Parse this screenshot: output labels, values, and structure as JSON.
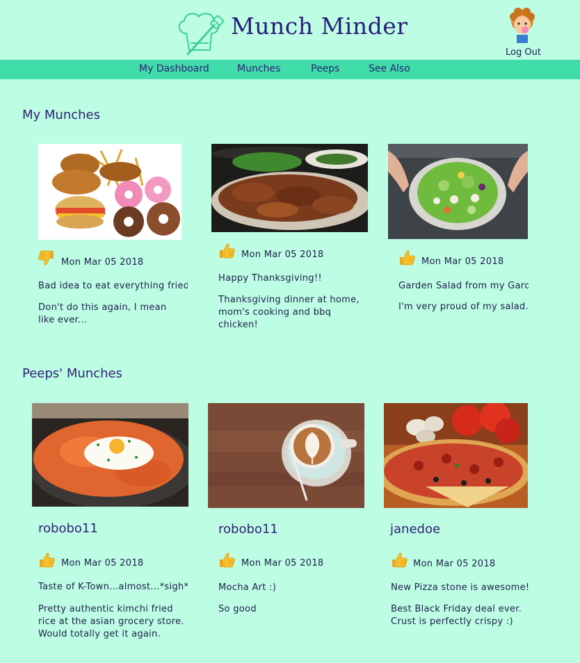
{
  "app": {
    "title": "Munch Minder",
    "logout_label": "Log Out"
  },
  "nav": {
    "items": [
      {
        "label": "My Dashboard"
      },
      {
        "label": "Munches"
      },
      {
        "label": "Peeps"
      },
      {
        "label": "See Also"
      }
    ]
  },
  "my_munches": {
    "title": "My Munches",
    "cards": [
      {
        "photo": "fried-food-photo",
        "rating": "thumbs-down",
        "date": "Mon Mar 05 2018",
        "title": "Bad idea to eat everything fried...",
        "body": "Don't do this again, I mean like ever..."
      },
      {
        "photo": "bbq-chicken-photo",
        "rating": "thumbs-up",
        "date": "Mon Mar 05 2018",
        "title": "Happy Thanksgiving!!",
        "body": "Thanksgiving dinner at home, mom's cooking and bbq chicken!"
      },
      {
        "photo": "garden-salad-photo",
        "rating": "thumbs-up",
        "date": "Mon Mar 05 2018",
        "title": "Garden Salad from my Garden",
        "body": "I'm very proud of my salad."
      }
    ]
  },
  "peeps_munches": {
    "title": "Peeps' Munches",
    "cards": [
      {
        "photo": "kimchi-fried-rice-photo",
        "user": "robobo11",
        "rating": "thumbs-up",
        "date": "Mon Mar 05 2018",
        "title": "Taste of K-Town...almost...*sigh*",
        "body": "Pretty authentic kimchi fried rice at the asian grocery store. Would totally get it again."
      },
      {
        "photo": "latte-art-photo",
        "user": "robobo11",
        "rating": "thumbs-up",
        "date": "Mon Mar 05 2018",
        "title": "Mocha Art :)",
        "body": "So good"
      },
      {
        "photo": "pizza-photo",
        "user": "janedoe",
        "rating": "thumbs-up",
        "date": "Mon Mar 05 2018",
        "title": "New Pizza stone is awesome!",
        "body": "Best Black Friday deal ever. Crust is perfectly crispy :)"
      }
    ]
  },
  "colors": {
    "background": "#bdfde4",
    "nav": "#40dca9",
    "text": "#2e1f74",
    "thumb": "#f7c02a"
  }
}
